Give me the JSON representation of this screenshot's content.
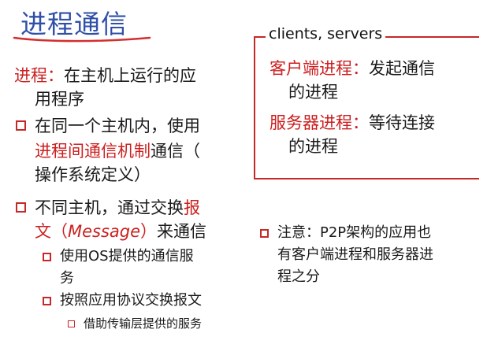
{
  "slide": {
    "title": "进程通信",
    "left": {
      "intro_term": "进程：",
      "intro_line1_rest": "在主机上运行的应",
      "intro_line2": "用程序",
      "bullet1": {
        "line1": "在同一个主机内，使用",
        "line2_red": "进程间通信机制",
        "line2_rest": "通信（",
        "line3": "操作系统定义）"
      },
      "bullet2": {
        "line1_a": "不同主机，通过交换",
        "line1_red": "报",
        "line2_red_a": "文（",
        "line2_msg": "Message",
        "line2_red_b": "）",
        "line2_rest": "来通信",
        "sub1_line1": "使用OS提供的通信服",
        "sub1_line2": "务",
        "sub2": "按照应用协议交换报文",
        "sub3": "借助传输层提供的服务"
      }
    },
    "right": {
      "box_label": "clients, servers",
      "client_term": "客户端进程：",
      "client_rest": "发起通信",
      "client_line2": "的进程",
      "server_term": "服务器进程：",
      "server_rest": "等待连接",
      "server_line2": "的进程",
      "note_line1": "注意：P2P架构的应用也",
      "note_line2": "有客户端进程和服务器进",
      "note_line3": "程之分"
    }
  },
  "colors": {
    "title": "#2f4fa8",
    "accent_red": "#cc1f1f",
    "text": "#1a1a1a"
  }
}
